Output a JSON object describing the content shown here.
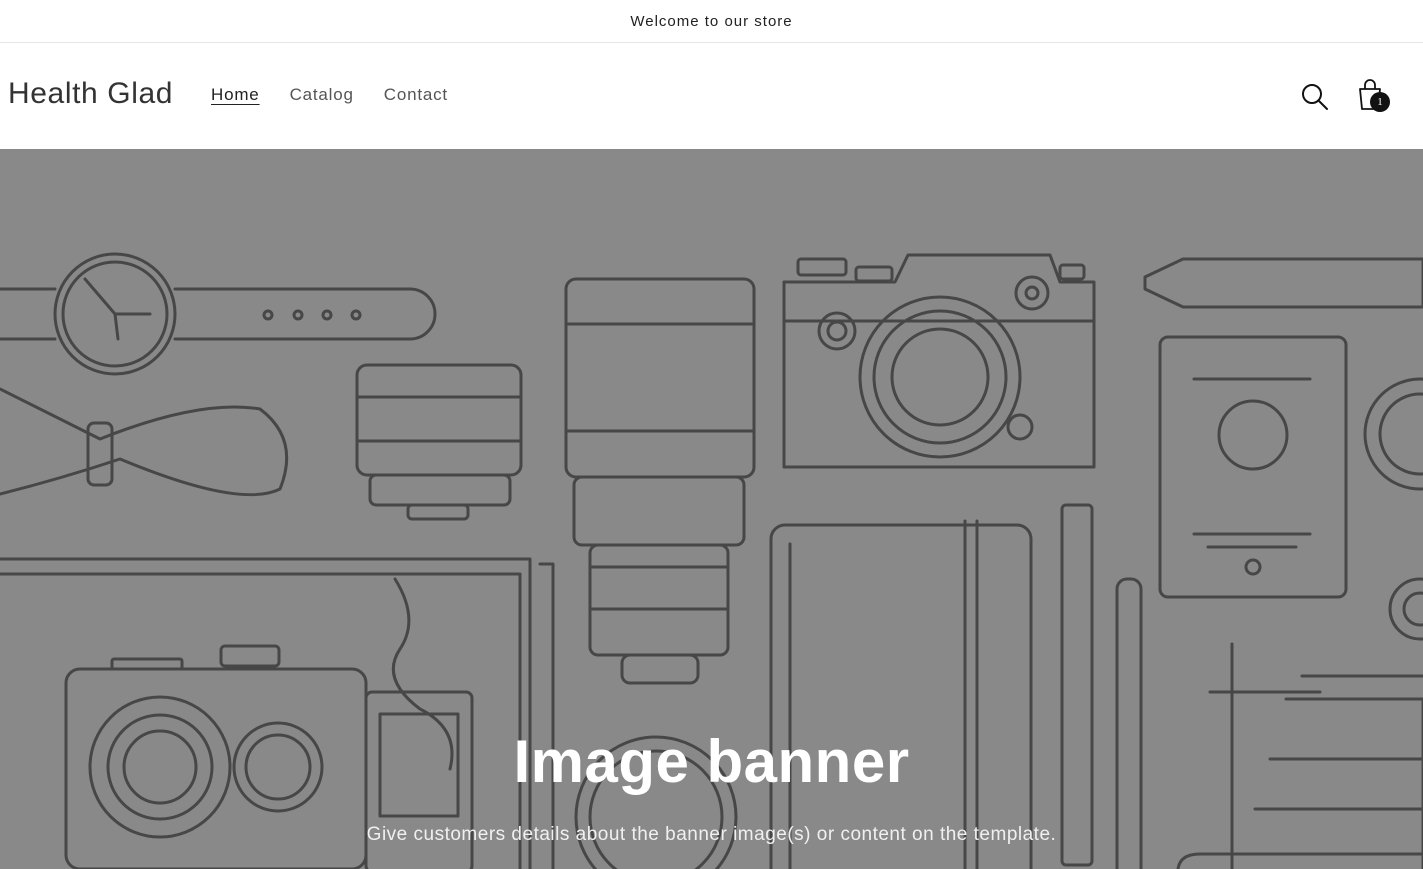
{
  "announcement": {
    "text": "Welcome to our store"
  },
  "header": {
    "logo": "Health Glad",
    "nav": [
      {
        "label": "Home",
        "active": true
      },
      {
        "label": "Catalog",
        "active": false
      },
      {
        "label": "Contact",
        "active": false
      }
    ],
    "search_icon": "search-icon",
    "cart_icon": "cart-icon",
    "cart_count": "1"
  },
  "banner": {
    "title": "Image banner",
    "subtitle": "Give customers details about the banner image(s) or content on the template.",
    "background": "#898989",
    "line_color": "#474747"
  }
}
